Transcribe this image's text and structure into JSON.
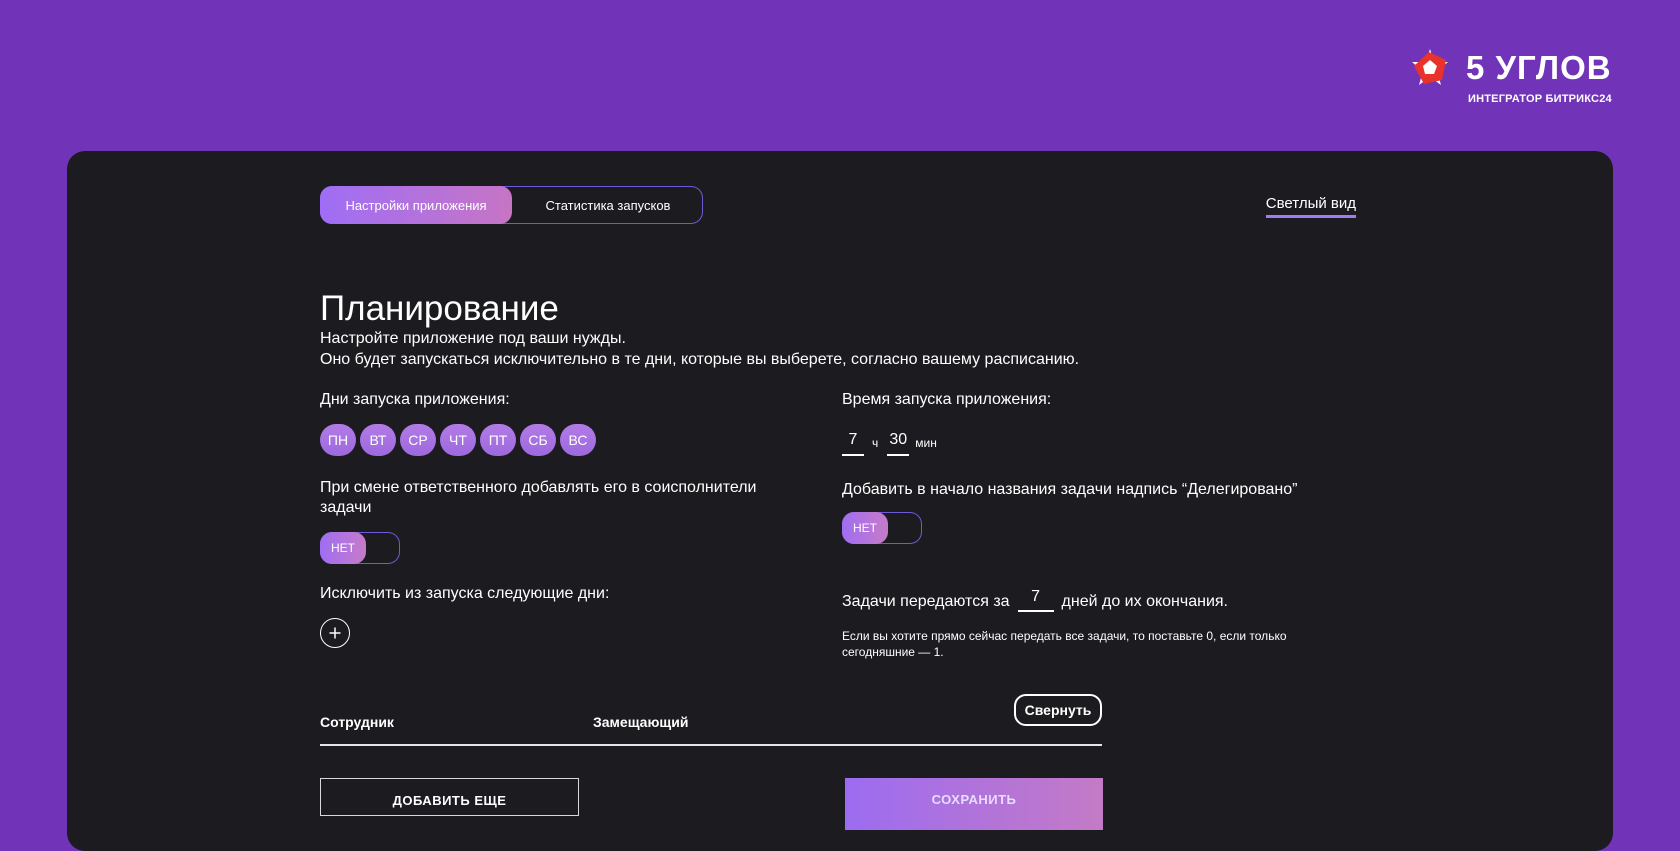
{
  "brand": {
    "title": "5 УГЛОВ",
    "subtitle": "ИНТЕГРАТОР БИТРИКС24"
  },
  "tabs": [
    {
      "label": "Настройки приложения",
      "active": true
    },
    {
      "label": "Статистика запусков",
      "active": false
    }
  ],
  "theme_toggle": "Светлый вид",
  "page": {
    "title": "Планирование",
    "desc_line1": "Настройте приложение под ваши нужды.",
    "desc_line2": "Оно будет запускаться исключительно в те дни, которые вы выберете, согласно вашему расписанию."
  },
  "launch_days": {
    "label": "Дни запуска приложения:",
    "days": [
      "ПН",
      "ВТ",
      "СР",
      "ЧТ",
      "ПТ",
      "СБ",
      "ВС"
    ]
  },
  "launch_time": {
    "label": "Время запуска приложения:",
    "hours": "7",
    "hours_unit": "ч",
    "minutes": "30",
    "minutes_unit": "мин"
  },
  "coexecutor": {
    "label": "При смене ответственного добавлять его в соисполнители задачи",
    "value": "НЕТ"
  },
  "delegated": {
    "label": "Добавить в начало названия задачи надпись “Делегировано”",
    "value": "НЕТ"
  },
  "exclude_days": {
    "label": "Исключить из запуска следующие дни:"
  },
  "transfer": {
    "prefix": "Задачи передаются за",
    "days": "7",
    "suffix": "дней до их окончания.",
    "note": "Если вы хотите прямо сейчас передать все задачи, то поставьте 0, если только сегодняшние — 1."
  },
  "table": {
    "col_employee": "Сотрудник",
    "col_substitute": "Замещающий",
    "collapse_label": "Свернуть"
  },
  "actions": {
    "add_more": "ДОБАВИТЬ ЕЩЕ",
    "save": "СОХРАНИТЬ"
  },
  "colors": {
    "background": "#7134b8",
    "panel": "#1c1b1f",
    "accent": "#a37af3",
    "brand_red": "#e8322b"
  }
}
